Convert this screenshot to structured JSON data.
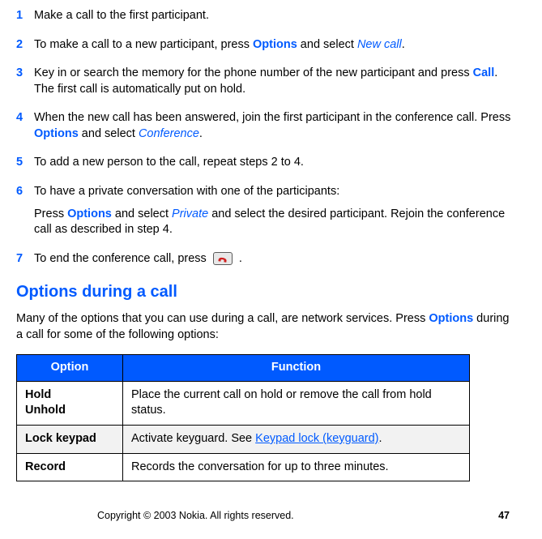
{
  "steps": [
    {
      "num": "1",
      "parts": [
        {
          "t": "Make a call to the first participant."
        }
      ]
    },
    {
      "num": "2",
      "parts": [
        {
          "t": "To make a call to a new participant, press "
        },
        {
          "t": "Options",
          "cls": "opt-bold"
        },
        {
          "t": " and select "
        },
        {
          "t": "New call",
          "cls": "opt-italic"
        },
        {
          "t": "."
        }
      ]
    },
    {
      "num": "3",
      "parts": [
        {
          "t": "Key in or search the memory for the phone number of the new participant and press "
        },
        {
          "t": "Call",
          "cls": "opt-bold"
        },
        {
          "t": ". The first call is automatically put on hold."
        }
      ]
    },
    {
      "num": "4",
      "parts": [
        {
          "t": "When the new call has been answered, join the first participant in the conference call. Press "
        },
        {
          "t": "Options",
          "cls": "opt-bold"
        },
        {
          "t": " and select "
        },
        {
          "t": "Conference",
          "cls": "opt-italic"
        },
        {
          "t": "."
        }
      ]
    },
    {
      "num": "5",
      "parts": [
        {
          "t": "To add a new person to the call, repeat steps 2 to 4."
        }
      ]
    },
    {
      "num": "6",
      "parts": [
        {
          "t": "To have a private conversation with one of the participants:"
        }
      ],
      "extra": [
        {
          "t": "Press "
        },
        {
          "t": "Options",
          "cls": "opt-bold"
        },
        {
          "t": " and select "
        },
        {
          "t": "Private",
          "cls": "opt-italic"
        },
        {
          "t": " and select the desired participant. Rejoin the conference call as described in step 4."
        }
      ]
    },
    {
      "num": "7",
      "parts": [
        {
          "t": "To end the conference call, press "
        },
        {
          "icon": "end-call"
        },
        {
          "t": " ."
        }
      ]
    }
  ],
  "section_heading": "Options during a call",
  "section_intro_parts": [
    {
      "t": "Many of the options that you can use during a call, are network services. Press "
    },
    {
      "t": "Options",
      "cls": "opt-bold"
    },
    {
      "t": " during a call for some of the following options:"
    }
  ],
  "table": {
    "headers": {
      "option": "Option",
      "function": "Function"
    },
    "rows": [
      {
        "option_lines": [
          "Hold",
          "Unhold"
        ],
        "func_parts": [
          {
            "t": "Place the current call on hold or remove the call from hold status."
          }
        ],
        "shade": "white"
      },
      {
        "option_lines": [
          "Lock keypad"
        ],
        "func_parts": [
          {
            "t": "Activate keyguard.  See "
          },
          {
            "t": "Keypad lock (keyguard)",
            "cls": "link-underline"
          },
          {
            "t": "."
          }
        ],
        "shade": "grey"
      },
      {
        "option_lines": [
          "Record"
        ],
        "func_parts": [
          {
            "t": "Records the conversation for up to three minutes."
          }
        ],
        "shade": "white"
      }
    ]
  },
  "footer": {
    "copyright": "Copyright © 2003 Nokia. All rights reserved.",
    "page": "47"
  }
}
